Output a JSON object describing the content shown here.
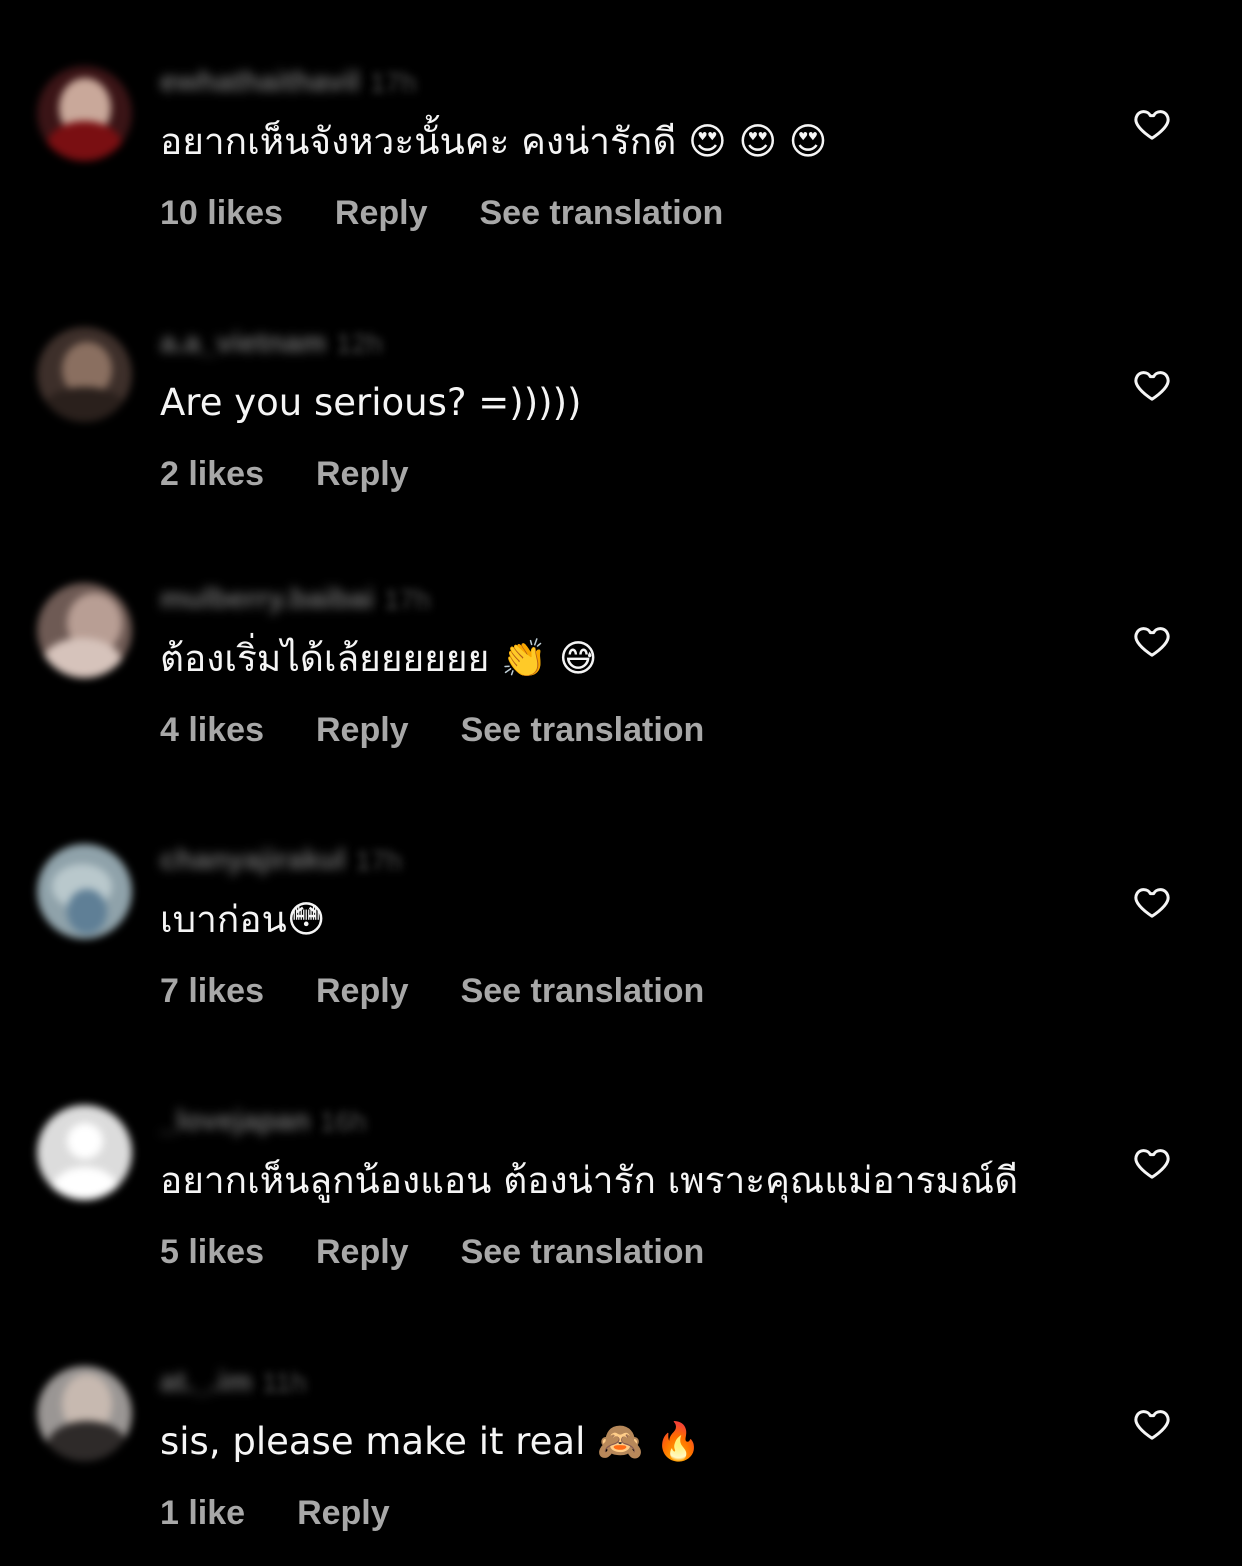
{
  "comments": [
    {
      "username": "ewhathaithavil",
      "time": "17h",
      "text": "อยากเห็นจังหวะนั้นคะ คงน่ารักดี 😍 😍 😍",
      "likes": "10 likes",
      "reply": "Reply",
      "translation": "See translation",
      "avatar_color": "#3a1416"
    },
    {
      "username": "a.a_vietnam",
      "time": "12h",
      "text": "Are you serious? =)))))",
      "likes": "2 likes",
      "reply": "Reply",
      "translation": "",
      "avatar_color": "#4a3a32"
    },
    {
      "username": "mulberry.baibai",
      "time": "17h",
      "text": "ต้องเริ่มได้เล้ยยยยยย 👏 😅",
      "likes": "4 likes",
      "reply": "Reply",
      "translation": "See translation",
      "avatar_color": "#6e5a54"
    },
    {
      "username": "chanyajirakul",
      "time": "17h",
      "text": "เบาก่อน😳",
      "likes": "7 likes",
      "reply": "Reply",
      "translation": "See translation",
      "avatar_color": "#7a8c94"
    },
    {
      "username": "_lovejapan",
      "time": "16h",
      "text": "อยากเห็นลูกน้องแอน ต้องน่ารัก เพราะคุณแม่อารมณ์ดี",
      "likes": "5 likes",
      "reply": "Reply",
      "translation": "See translation",
      "avatar_color": "#d9d9d9"
    },
    {
      "username": "at._.im",
      "time": "11h",
      "text": "sis, please make it real 🙈 🔥",
      "likes": "1 like",
      "reply": "Reply",
      "translation": "",
      "avatar_color": "#5a5654"
    }
  ],
  "colors": {
    "background": "#000000",
    "text": "#f5f5f5",
    "secondary": "#a8a8a8"
  },
  "icons": {
    "like": "heart-outline-icon"
  }
}
